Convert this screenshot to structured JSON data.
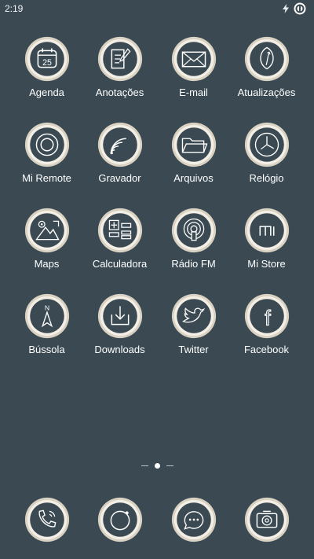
{
  "status_bar": {
    "time": "2:19",
    "icons": [
      "bolt-icon",
      "data-saver-icon"
    ]
  },
  "apps": [
    {
      "label": "Agenda",
      "icon": "calendar-icon",
      "day": "25"
    },
    {
      "label": "Anotações",
      "icon": "notes-icon"
    },
    {
      "label": "E-mail",
      "icon": "mail-icon"
    },
    {
      "label": "Atualizações",
      "icon": "update-icon"
    },
    {
      "label": "Mi Remote",
      "icon": "remote-icon"
    },
    {
      "label": "Gravador",
      "icon": "recorder-icon"
    },
    {
      "label": "Arquivos",
      "icon": "folder-icon"
    },
    {
      "label": "Relógio",
      "icon": "clock-icon"
    },
    {
      "label": "Maps",
      "icon": "map-icon"
    },
    {
      "label": "Calculadora",
      "icon": "calculator-icon"
    },
    {
      "label": "Rádio FM",
      "icon": "radio-icon"
    },
    {
      "label": "Mi Store",
      "icon": "mi-store-icon",
      "logo_text": "mi"
    },
    {
      "label": "Bússola",
      "icon": "compass-icon",
      "letter": "N"
    },
    {
      "label": "Downloads",
      "icon": "download-icon"
    },
    {
      "label": "Twitter",
      "icon": "twitter-icon"
    },
    {
      "label": "Facebook",
      "icon": "facebook-icon",
      "letter": "f"
    }
  ],
  "page_indicator": {
    "current": 2,
    "total": 3
  },
  "dock": [
    {
      "icon": "phone-icon"
    },
    {
      "icon": "browser-icon"
    },
    {
      "icon": "messages-icon"
    },
    {
      "icon": "camera-icon"
    }
  ],
  "colors": {
    "background": "#3b4a52",
    "ring_outer": "#d9d2c3",
    "ring_inner": "#f3efe6",
    "icon_fill": "#3b4a52",
    "glyph": "#ffffff"
  }
}
